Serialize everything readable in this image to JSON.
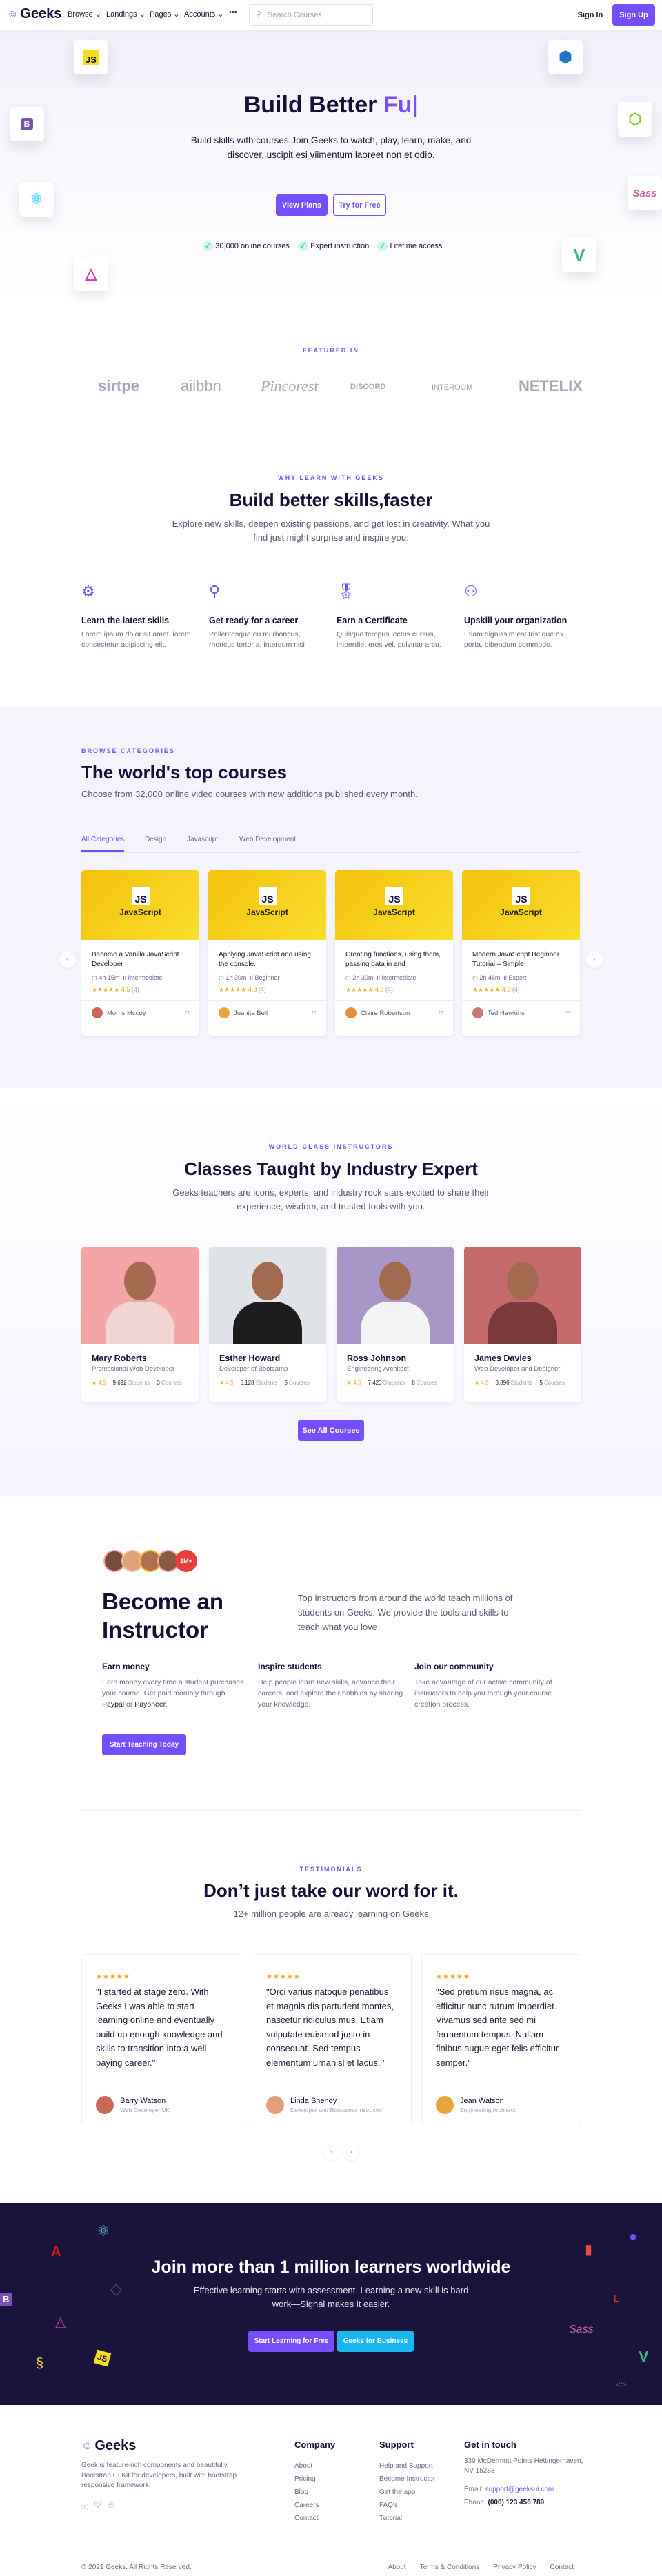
{
  "colors": {
    "primary": "#754ffe",
    "dark": "#150f3a",
    "success": "#19cb98",
    "cta_bg": "#1a143c",
    "secondary_cta": "#19b6f0"
  },
  "nav": {
    "brand": "Geeks",
    "items": [
      {
        "label": "Browse"
      },
      {
        "label": "Landings"
      },
      {
        "label": "Pages"
      },
      {
        "label": "Accounts"
      }
    ],
    "more": "•••",
    "search_placeholder": "Search Courses",
    "sign_in": "Sign In",
    "sign_up": "Sign Up"
  },
  "hero": {
    "title": "Build Better ",
    "title_accent": "Fu",
    "subtitle": "Build skills with courses Join Geeks to watch, play, learn, make, and discover, uscipit esi viimentum laoreet non et odio.",
    "primary_btn": "View Plans",
    "secondary_btn": "Try for Free",
    "checks": [
      "30,000 online courses",
      "Expert instruction",
      "Lifetime access"
    ],
    "tech_icons": [
      "javascript-icon",
      "webpack-icon",
      "bootstrap-icon",
      "nodejs-icon",
      "react-icon",
      "sass-icon",
      "vue-icon",
      "graphql-icon"
    ]
  },
  "featured": {
    "label": "FEATURED IN",
    "logos": [
      "sirtpe",
      "aiibbn",
      "Pincorest",
      "DISOORD",
      "INTEROOM",
      "NETELIX"
    ]
  },
  "why": {
    "label": "WHY LEARN WITH GEEKS",
    "title": "Build better skills,faster",
    "text": "Explore new skills, deepen existing passions, and get lost in creativity. What you find just might surprise and inspire you.",
    "features": [
      {
        "icon": "gear-icon",
        "title": "Learn the latest skills",
        "text": "Lorem ipsum dolor sit amet, lorem consectetur adipiscing elit."
      },
      {
        "icon": "user-icon",
        "title": "Get ready for a career",
        "text": "Pellentesque eu mi rhoncus, rhoncus tortor a, interdum nisi"
      },
      {
        "icon": "award-icon",
        "title": "Earn a Certificate",
        "text": "Quisque tempus lectus cursus, imperdiet eros vel, pulvinar arcu."
      },
      {
        "icon": "users-icon",
        "title": "Upskill your organization",
        "text": "Etiam dignissim est tristique ex porta, bibendum commodo."
      }
    ]
  },
  "courses": {
    "label": "BROWSE CATEGORIES",
    "title": "The world's top courses",
    "text": "Choose from 32,000 online video courses with new additions published every month.",
    "tabs": [
      "All Categories",
      "Design",
      "Javascript",
      "Web Development"
    ],
    "active_tab": "All Categories",
    "items": [
      {
        "badge": "JS",
        "category": "JavaScript",
        "title": "Become a Vanilla JavaScript Developer",
        "duration": "4h 15m",
        "level": "Intermediate",
        "stars": "★★★★★",
        "rating": "4.5",
        "reviews": "(4)",
        "author": "Morris Mccoy",
        "avatar": "#c86a5a"
      },
      {
        "badge": "JS",
        "category": "JavaScript",
        "title": "Applying JavaScript and using the console.",
        "duration": "1h 30m",
        "level": "Beginner",
        "stars": "★★★★★",
        "rating": "4.3",
        "reviews": "(4)",
        "author": "Juanita Bell",
        "avatar": "#e5a93b"
      },
      {
        "badge": "JS",
        "category": "JavaScript",
        "title": "Creating functions, using them, passing data in and",
        "duration": "2h 30m",
        "level": "Intermediate",
        "stars": "★★★★★",
        "rating": "4.8",
        "reviews": "(4)",
        "author": "Claire Robertson",
        "avatar": "#e59040"
      },
      {
        "badge": "JS",
        "category": "JavaScript",
        "title": "Modern JavaScript Beginner Tutorial – Simple",
        "duration": "2h 46m",
        "level": "Expert",
        "stars": "★★★★★",
        "rating": "4.8",
        "reviews": "(4)",
        "author": "Ted Hawkins",
        "avatar": "#c77a74"
      }
    ]
  },
  "instructors": {
    "label": "WORLD-CLASS INSTRUCTORS",
    "title": "Classes Taught by Industry Expert",
    "text": "Geeks teachers are icons, experts, and industry rock stars excited to share their experience, wisdom, and trusted tools with you.",
    "button": "See All Courses",
    "items": [
      {
        "name": "Mary Roberts",
        "role": "Professional Web Developer",
        "rating": "★ 4.5",
        "students": "9,692",
        "students_label": "Students",
        "courses": "3",
        "courses_label": "Courses",
        "bg": "#f4a5a5",
        "shirt": "#f1d5d2"
      },
      {
        "name": "Esther Howard",
        "role": "Developer of Bootcamp",
        "rating": "★ 4.5",
        "students": "5,128",
        "students_label": "Students",
        "courses": "5",
        "courses_label": "Courses",
        "bg": "#dfe3e8",
        "shirt": "#1c1c1c"
      },
      {
        "name": "Ross Johnson",
        "role": "Engineering Architect",
        "rating": "★ 4.5",
        "students": "7,423",
        "students_label": "Students",
        "courses": "8",
        "courses_label": "Courses",
        "bg": "#a897c6",
        "shirt": "#f4f4f4"
      },
      {
        "name": "James Davies",
        "role": "Web Developer and Designer",
        "rating": "★ 4.5",
        "students": "3,896",
        "students_label": "Students",
        "courses": "5",
        "courses_label": "Courses",
        "bg": "#c56b6b",
        "shirt": "#7a3a3a"
      }
    ]
  },
  "become": {
    "badge": "1M+",
    "title_line1": "Become an",
    "title_line2": "Instructor",
    "text": "Top instructors from around the world teach millions of students on Geeks. We provide the tools and skills to teach what you love",
    "features": [
      {
        "title": "Earn money",
        "text_before": "Earn money every time a student purchases your course. Get paid monthly through ",
        "link1": "Paypal",
        "mid": " or ",
        "link2": "Payoneer."
      },
      {
        "title": "Inspire students",
        "text": "Help people learn new skills, advance their careers, and explore their hobbies by sharing your knowledge."
      },
      {
        "title": "Join our community",
        "text": "Take advantage of our active community of instructors to help you through your course creation process."
      }
    ],
    "button": "Start Teaching Today"
  },
  "testimonials": {
    "label": "TESTIMONIALS",
    "title": "Don’t just take our word for it.",
    "text": "12+ million people are already learning on Geeks",
    "items": [
      {
        "stars": "★★★★★",
        "quote": "\"I started at stage zero. With Geeks I was able to start learning online and eventually build up enough knowledge and skills to transition into a well-paying career.\"",
        "name": "Barry Watson",
        "role": "Web Developer,UK",
        "avatar": "#c86a5a"
      },
      {
        "stars": "★★★★★",
        "quote": "\"Orci varius natoque penatibus et magnis dis parturient montes, nascetur ridiculus mus. Etiam vulputate euismod justo in consequat. Sed tempus elementum urnanisl et lacus. \"",
        "name": "Linda Shenoy",
        "role": "Developer and Bootcamp Instructor",
        "avatar": "#e0a07a"
      },
      {
        "stars": "★★★★★",
        "quote": "\"Sed pretium risus magna, ac efficitur nunc rutrum imperdiet. Vivamus sed ante sed mi fermentum tempus. Nullam finibus augue eget felis efficitur semper.\"",
        "name": "Jean Watson",
        "role": "Engineering Architect",
        "avatar": "#e5a93b"
      }
    ]
  },
  "cta": {
    "title": "Join more than 1 million learners worldwide",
    "text": "Effective learning starts with assessment. Learning a new skill is hard work—Signal makes it easier.",
    "primary": "Start Learning for Free",
    "secondary": "Geeks for Business"
  },
  "footer": {
    "brand": "Geeks",
    "about": "Geek is feature-rich components and beautifully Bootstrap UI Kit for developers, built with bootstrap responsive framework.",
    "social": [
      "facebook-icon",
      "twitter-icon",
      "github-icon"
    ],
    "company": {
      "title": "Company",
      "links": [
        "About",
        "Pricing",
        "Blog",
        "Careers",
        "Contact"
      ]
    },
    "support": {
      "title": "Support",
      "links": [
        "Help and Support",
        "Become Instructor",
        "Get the app",
        "FAQ's",
        "Tutorial"
      ]
    },
    "contact": {
      "title": "Get in touch",
      "address": "339 McDermott Points Hettingerhaven, NV 15283",
      "email_label": "Email: ",
      "email": "support@geeksui.com",
      "phone_label": "Phone: ",
      "phone": "(000) 123 456 789"
    },
    "copyright": "© 2021 Geeks. All Rights Reserved.",
    "bottom_links": [
      "About",
      "Terms & Conditions",
      "Privacy Policy",
      "Contact"
    ]
  }
}
